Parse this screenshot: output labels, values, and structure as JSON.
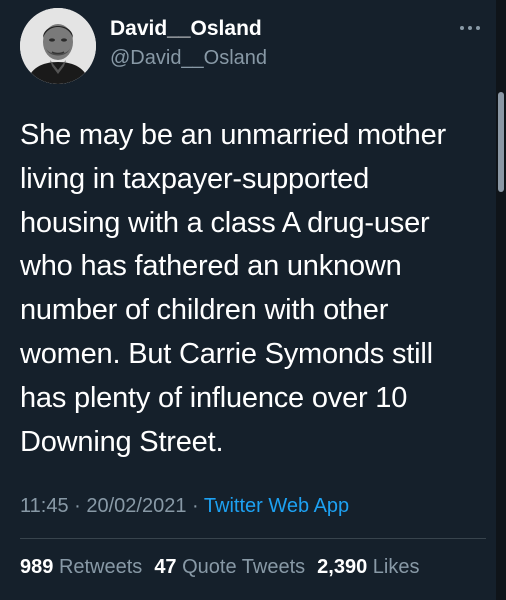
{
  "author": {
    "display_name": "David__Osland",
    "handle": "@David__Osland",
    "avatar_icon": "profile-photo"
  },
  "tweet": {
    "lines": [
      "She may be an unmarried mother",
      "living in taxpayer-supported",
      "housing with a class A drug-user",
      "who has fathered an unknown",
      "number of children with other",
      "women. But Carrie Symonds still",
      "has plenty of influence over 10",
      "Downing Street."
    ]
  },
  "meta": {
    "time": "11:45",
    "separator": "·",
    "date": "20/02/2021",
    "source": "Twitter Web App"
  },
  "stats": {
    "retweets_count": "989",
    "retweets_label": "Retweets",
    "quotes_count": "47",
    "quotes_label": "Quote Tweets",
    "likes_count": "2,390",
    "likes_label": "Likes"
  },
  "colors": {
    "background": "#15202b",
    "text": "#ffffff",
    "secondary": "#8899a6",
    "link": "#1da1f2",
    "divider": "#38444d"
  }
}
